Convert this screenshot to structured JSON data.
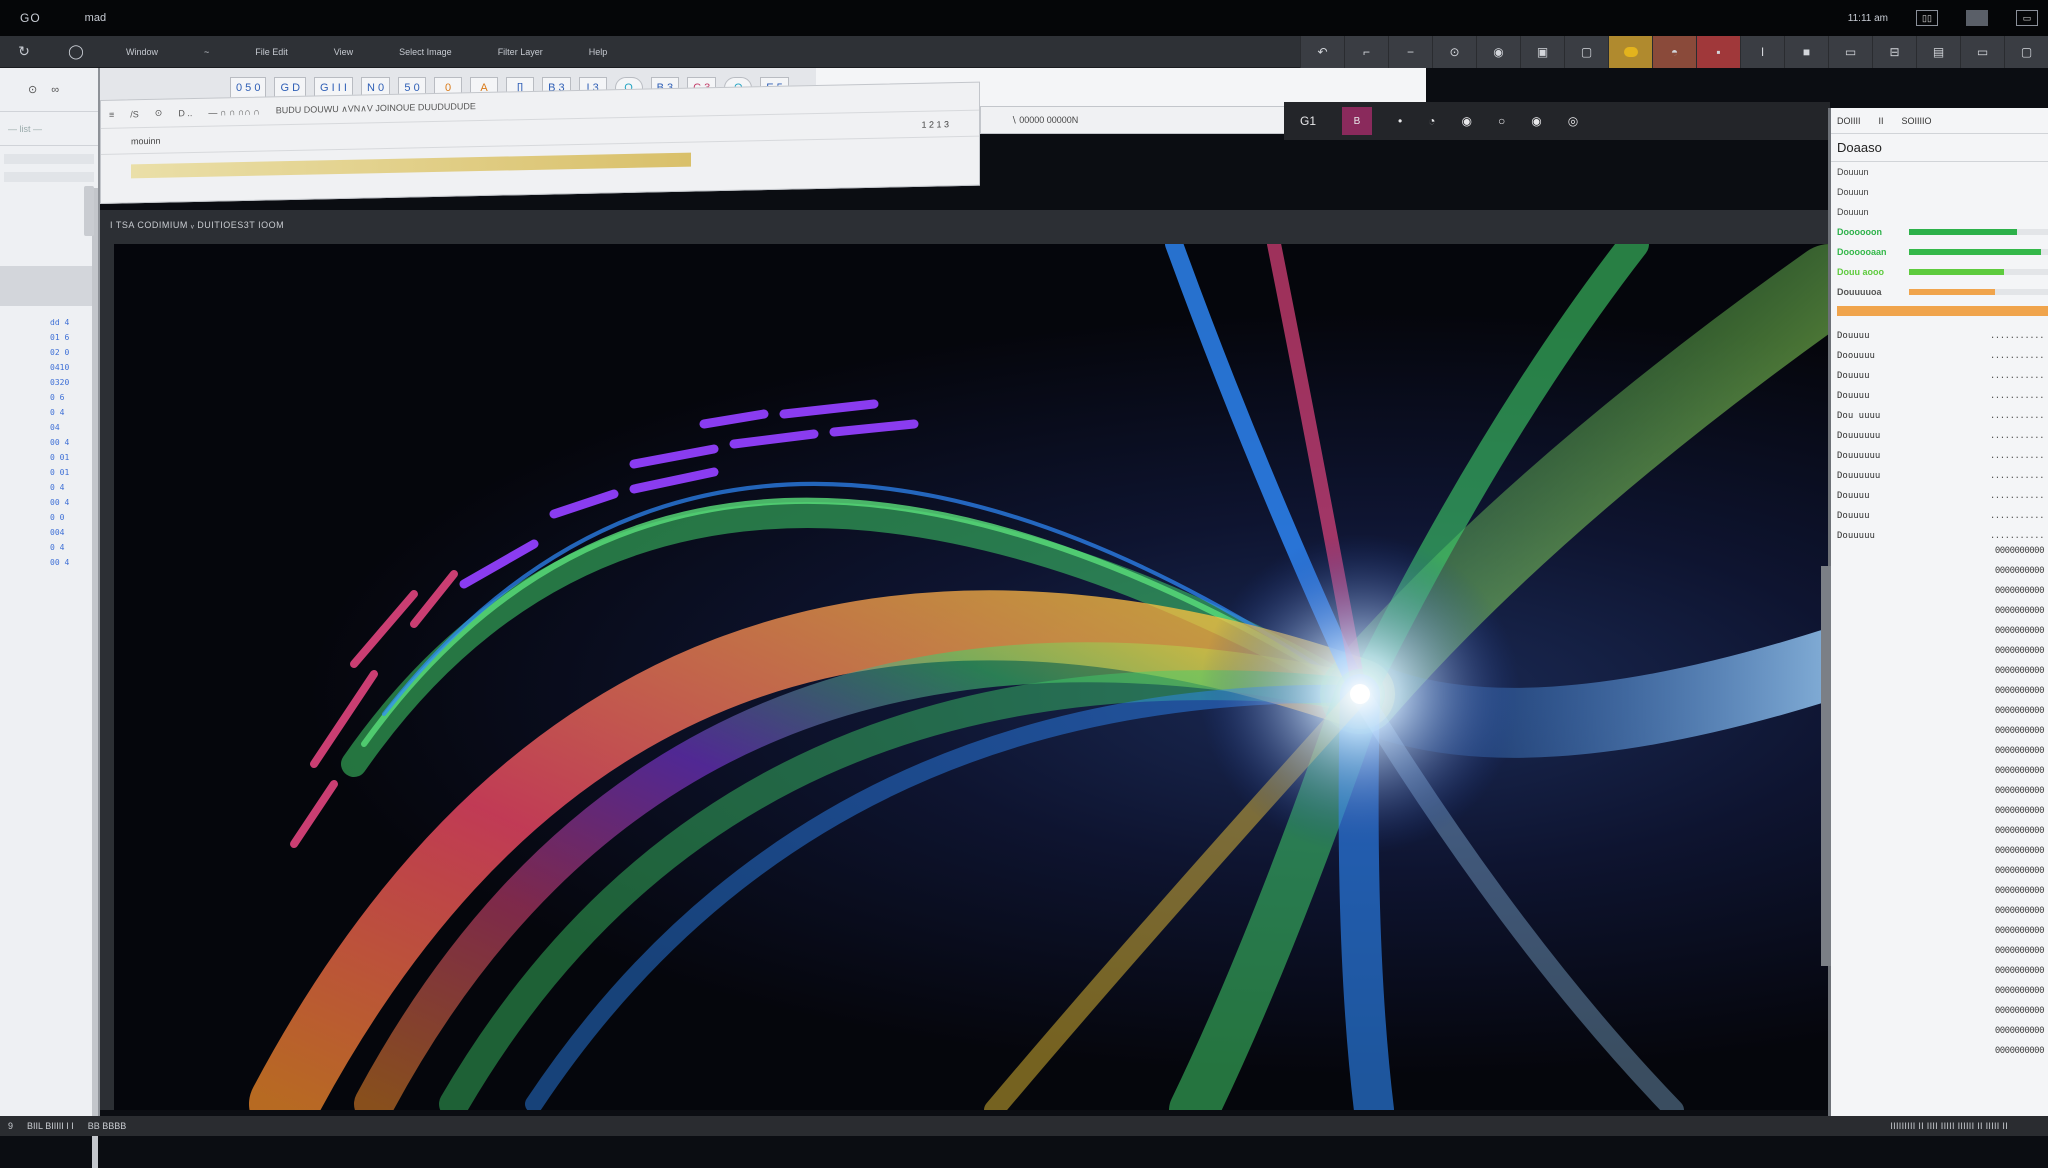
{
  "system_bar": {
    "glyph": "GO",
    "app_name": "mad",
    "clock": "11:11 am",
    "icons": [
      "window-grid-icon",
      "square-icon",
      "display-icon"
    ]
  },
  "toolbar": {
    "menu": [
      "Window",
      "~",
      "File Edit",
      "View",
      "Select Image",
      "Filter Layer",
      "Help"
    ],
    "tools": [
      "rotate-icon",
      "crop-icon",
      "minus-icon",
      "target-icon",
      "eye-icon",
      "frame-icon",
      "device-icon",
      "color-dot-icon",
      "brush-icon",
      "stop-icon",
      "text-cursor-icon",
      "square-icon",
      "grid-icon",
      "layout-icon",
      "panel-icon",
      "split-icon",
      "window-icon",
      "screen-icon"
    ]
  },
  "left_panel": {
    "row1_icons": [
      "target-icon",
      "infinity-icon"
    ],
    "row2_text": "— list —",
    "list_items": [
      "dd 4",
      "01 6",
      "02 0",
      "0410",
      "0320",
      "0 6",
      "0 4",
      "04",
      "00 4",
      "0 01",
      "0 01",
      "0 4",
      "00 4",
      "0 0",
      "004",
      "0 4",
      "00 4"
    ]
  },
  "inner_window": {
    "tab_boxes": [
      "0 5 0",
      "G  D",
      "G  I  I  I",
      "N  0",
      "5  0",
      "0",
      "A",
      "[]",
      "B  3",
      "I  3",
      "O",
      "B  3",
      "C  3",
      "O",
      "E  5"
    ]
  },
  "path_bar": {
    "line1_items": [
      "≡",
      "/S",
      "⊙",
      "D  ..",
      "—  ∩ ∩  ∩∩ ∩",
      "BUDU DOUWU ∧VN∧V  JOINOUE DUUDUDUDE"
    ],
    "line2_label": "mouinn",
    "line2_right": "1 2 1 3",
    "search_label": "∖  00000  00000N"
  },
  "canvas_window": {
    "title": "I  TSA  CODIMIUM  ᵥ       DUITIOES3T IOOM",
    "header_items": [
      "G1",
      "B",
      "•",
      "◔",
      "◉",
      "○",
      "◉",
      "◎"
    ]
  },
  "right_panel": {
    "head": [
      "DOIIII",
      "II",
      "SOIIIIO"
    ],
    "title": "Doaaso",
    "labels": [
      "Douuun",
      "Douuun",
      "Douuun"
    ],
    "progress": [
      {
        "name": "Doooooon",
        "value": 0.78,
        "color": "#2db14a"
      },
      {
        "name": "Doooooaan",
        "value": 0.95,
        "color": "#35b84a"
      },
      {
        "name": "Douu  aooo",
        "value": 0.68,
        "color": "#5ecb3e"
      },
      {
        "name": "Douuuuoa",
        "value": 0.62,
        "color": "#f0a44c"
      }
    ],
    "kv": [
      {
        "k": "Douuuu",
        "v": "..........."
      },
      {
        "k": "Doouuuu",
        "v": "..........."
      },
      {
        "k": "Douuuu",
        "v": "..........."
      },
      {
        "k": "Douuuu",
        "v": "..........."
      },
      {
        "k": "Dou  uuuu",
        "v": "..........."
      },
      {
        "k": "Douuuuuu",
        "v": "..........."
      },
      {
        "k": "Douuuuuu",
        "v": "..........."
      },
      {
        "k": "Douuuuuu",
        "v": "..........."
      },
      {
        "k": "Douuuu",
        "v": "..........."
      },
      {
        "k": "Douuuu",
        "v": "..........."
      },
      {
        "k": "Douuuuu",
        "v": "..........."
      }
    ],
    "values": [
      "0000000000",
      "0000000000",
      "0000000000",
      "0000000000",
      "0000000000",
      "0000000000",
      "0000000000",
      "0000000000",
      "0000000000",
      "0000000000",
      "0000000000",
      "0000000000",
      "0000000000",
      "0000000000",
      "0000000000",
      "0000000000",
      "0000000000",
      "0000000000",
      "0000000000",
      "0000000000",
      "0000000000",
      "0000000000",
      "0000000000",
      "0000000000",
      "0000000000",
      "0000000000"
    ]
  },
  "status_bar": {
    "left": [
      "9",
      "BIIL BIIIII  I  I",
      "BB  BBBB"
    ],
    "right": "IIIIIIIII  II  IIII  IIIII  IIIIII  II  IIIII  II"
  },
  "colors": {
    "accent_magenta": "#e0457d",
    "accent_purple": "#8a3cf0",
    "accent_green": "#3fd06a",
    "accent_yellow": "#ffd23a",
    "accent_blue": "#2f8cff",
    "accent_orange": "#f38b2a"
  }
}
